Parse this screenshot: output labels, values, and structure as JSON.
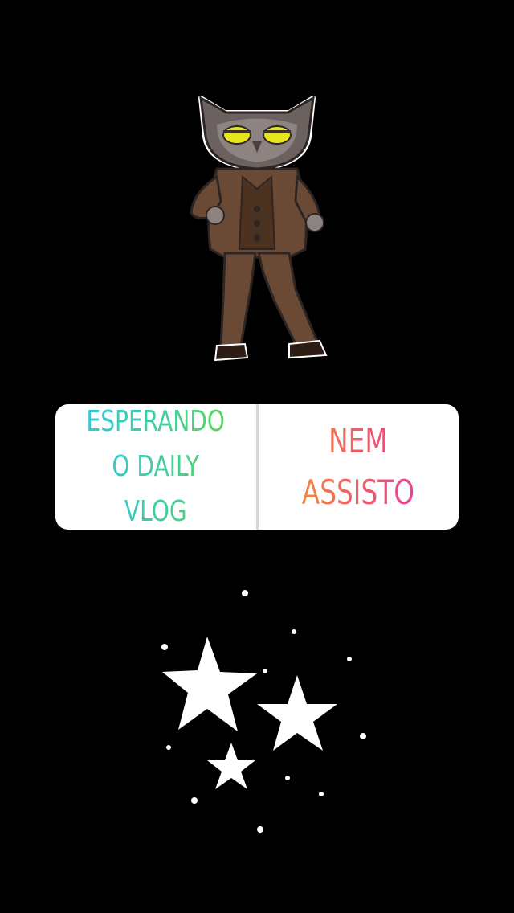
{
  "story": {
    "background_color": "#000000",
    "owl_sticker": {
      "icon": "dancing-owl-in-suit"
    },
    "poll": {
      "options": [
        {
          "label": "ESPERANDO\nO DAILY VLOG",
          "gradient": [
            "#31c6e3",
            "#59d74f"
          ]
        },
        {
          "label": "NEM\nASSISTO",
          "gradient": [
            "#ee8a44",
            "#e54592"
          ]
        }
      ]
    },
    "stars_sticker": {
      "icon": "sparkle-stars"
    }
  }
}
